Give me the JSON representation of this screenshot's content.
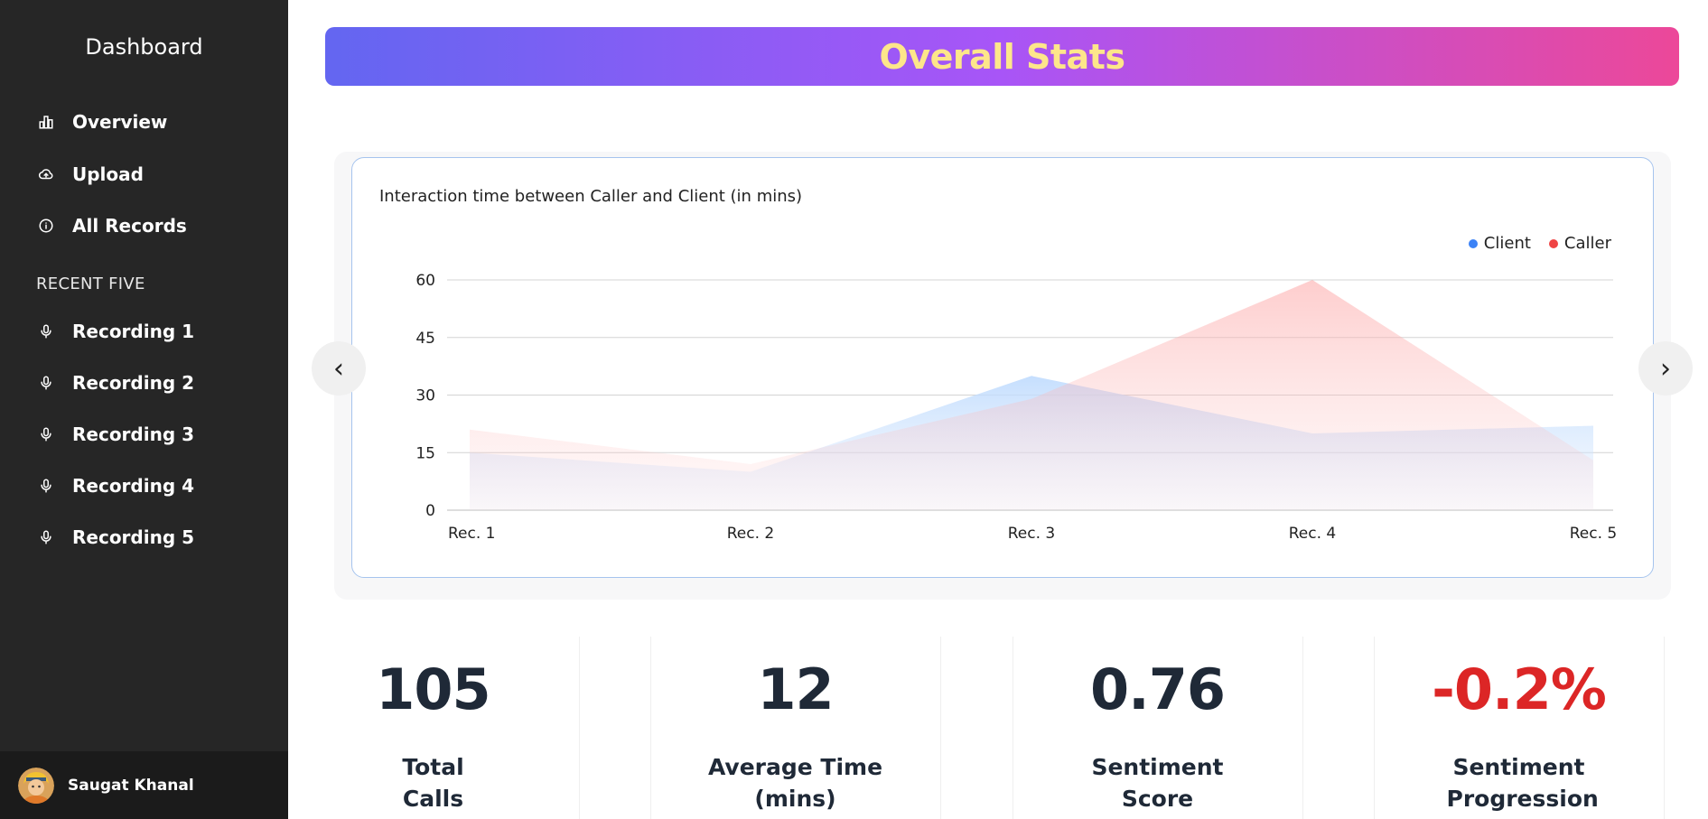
{
  "sidebar": {
    "brand": "Dashboard",
    "nav": [
      {
        "label": "Overview",
        "icon": "bar-chart-icon"
      },
      {
        "label": "Upload",
        "icon": "cloud-upload-icon"
      },
      {
        "label": "All Records",
        "icon": "info-icon"
      }
    ],
    "section_title": "RECENT FIVE",
    "recent": [
      {
        "label": "Recording 1",
        "icon": "microphone-icon"
      },
      {
        "label": "Recording 2",
        "icon": "microphone-icon"
      },
      {
        "label": "Recording 3",
        "icon": "microphone-icon"
      },
      {
        "label": "Recording 4",
        "icon": "microphone-icon"
      },
      {
        "label": "Recording 5",
        "icon": "microphone-icon"
      }
    ],
    "user": {
      "name": "Saugat Khanal"
    }
  },
  "header": {
    "title": "Overall Stats"
  },
  "carousel": {
    "prev": "‹",
    "next": "›"
  },
  "chart_data": {
    "type": "area",
    "title": "Interaction time between Caller and Client (in mins)",
    "categories": [
      "Rec. 1",
      "Rec. 2",
      "Rec. 3",
      "Rec. 4",
      "Rec. 5"
    ],
    "series": [
      {
        "name": "Client",
        "values": [
          15,
          10,
          35,
          20,
          22
        ],
        "color": "#3b82f6"
      },
      {
        "name": "Caller",
        "values": [
          21,
          12,
          29,
          60,
          13
        ],
        "color": "#ef4444"
      }
    ],
    "yticks": [
      0,
      15,
      30,
      45,
      60
    ],
    "ylim": [
      0,
      60
    ],
    "grid": true,
    "legend": "top-right"
  },
  "stats": [
    {
      "value": "105",
      "label": "Total Calls",
      "color": "#1f2937"
    },
    {
      "value": "12",
      "label": "Average Time (mins)",
      "color": "#1f2937"
    },
    {
      "value": "0.76",
      "label": "Sentiment Score",
      "color": "#1f2937"
    },
    {
      "value": "-0.2%",
      "label": "Sentiment Progression",
      "color": "#dc2626"
    }
  ]
}
